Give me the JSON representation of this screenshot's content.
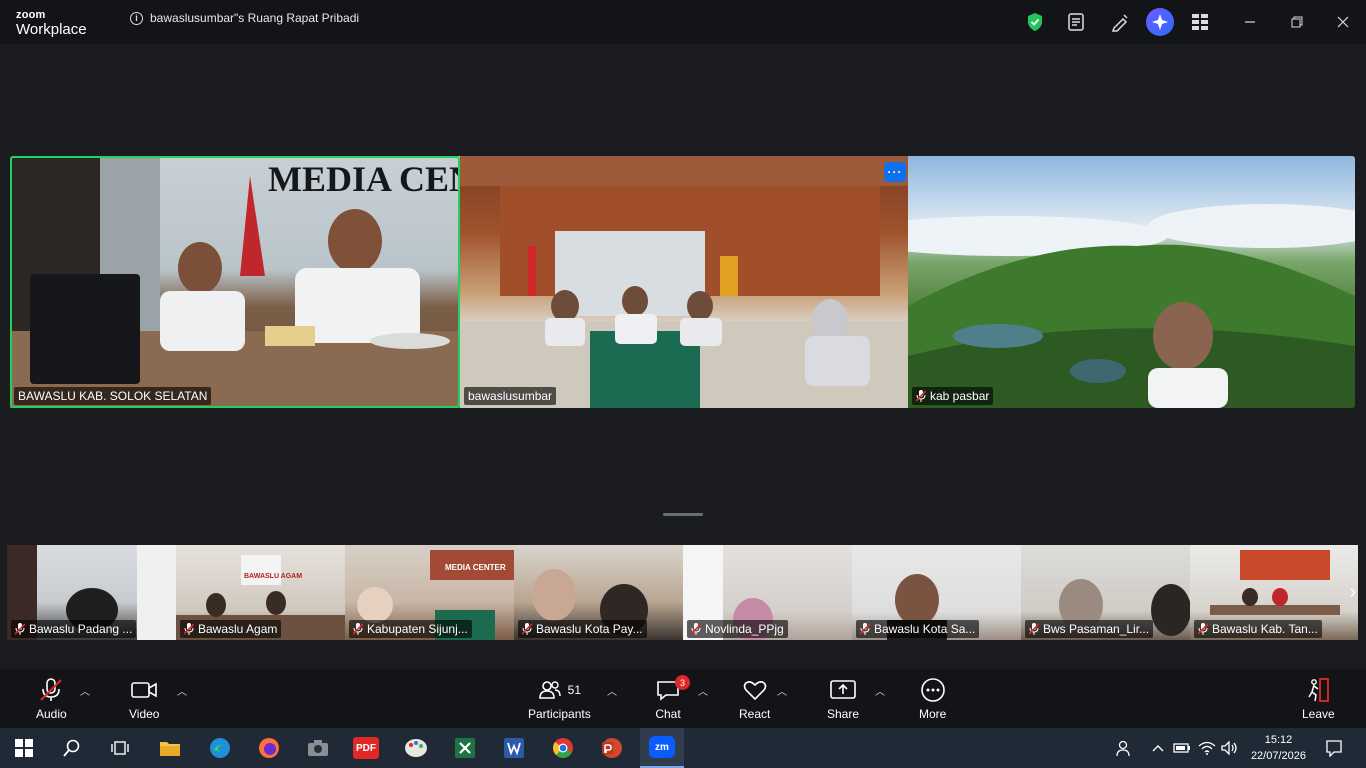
{
  "app": {
    "brand_line1": "zoom",
    "brand_line2": "Workplace",
    "meeting_title": "bawaslusumbar\"s Ruang Rapat Pribadi"
  },
  "main_tiles": [
    {
      "name": "BAWASLU KAB. SOLOK SELATAN",
      "muted": false,
      "active": true
    },
    {
      "name": "bawaslusumbar",
      "muted": false,
      "active": false
    },
    {
      "name": "kab pasbar",
      "muted": true,
      "active": false
    }
  ],
  "strip_tiles": [
    {
      "name": "Bawaslu Padang ...",
      "muted": true
    },
    {
      "name": "Bawaslu Agam",
      "muted": true
    },
    {
      "name": "Kabupaten Sijunj...",
      "muted": true
    },
    {
      "name": "Bawaslu Kota Pay...",
      "muted": true
    },
    {
      "name": "Novlinda_PPjg",
      "muted": true
    },
    {
      "name": "Bawaslu Kota Sa...",
      "muted": true
    },
    {
      "name": "Bws Pasaman_Lir...",
      "muted": true
    },
    {
      "name": "Bawaslu Kab. Tan...",
      "muted": true
    }
  ],
  "overlay_text": {
    "media_center": "MEDIA CENTER",
    "strip_media_center": "MEDIA CENTER",
    "bawaslu_agam": "BAWASLU AGAM"
  },
  "more_dots": "···",
  "toolbar": {
    "audio": "Audio",
    "video": "Video",
    "participants": "Participants",
    "participants_count": "51",
    "chat": "Chat",
    "chat_badge": "3",
    "react": "React",
    "share": "Share",
    "more": "More",
    "leave": "Leave"
  },
  "taskbar": {
    "time": "15:12",
    "date": "22/07/2026",
    "pdf_label": "PDF",
    "zoom_label": "zm"
  },
  "colors": {
    "active_speaker": "#23d160",
    "accent": "#0e71eb",
    "badge": "#e02828"
  }
}
